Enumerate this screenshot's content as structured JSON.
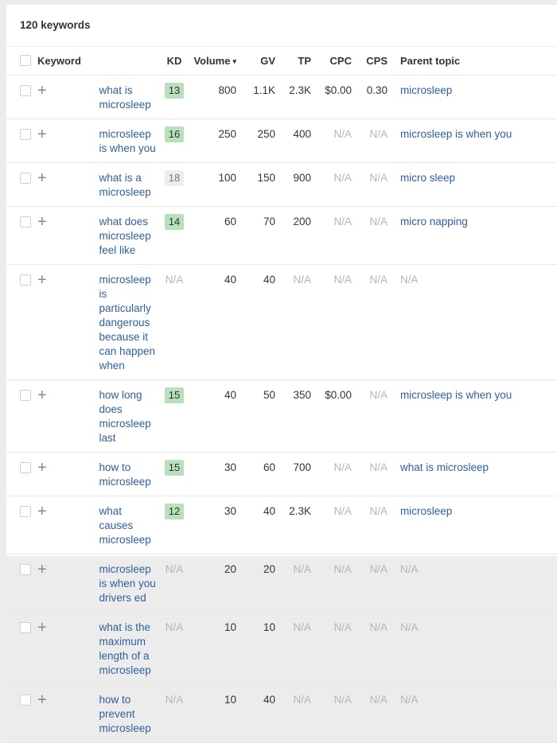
{
  "panel": {
    "title": "120 keywords"
  },
  "columns": {
    "keyword": "Keyword",
    "kd": "KD",
    "volume": "Volume",
    "volume_sort_icon": "caret-down",
    "volume_sort_glyph": "▾",
    "gv": "GV",
    "tp": "TP",
    "cpc": "CPC",
    "cps": "CPS",
    "parent_topic": "Parent topic"
  },
  "icons": {
    "add": "+"
  },
  "colors": {
    "link": "#2f5f9e",
    "kd_green": "#b7e0bb",
    "kd_gray": "#ededed",
    "na_text": "#b5b5b5"
  },
  "rows": [
    {
      "keyword": "what is microsleep",
      "kd": "13",
      "kd_style": "green",
      "volume": "800",
      "gv": "1.1K",
      "tp": "2.3K",
      "cpc": "$0.00",
      "cps": "0.30",
      "parent_topic": "microsleep"
    },
    {
      "keyword": "microsleep is when you",
      "kd": "16",
      "kd_style": "green",
      "volume": "250",
      "gv": "250",
      "tp": "400",
      "cpc": "N/A",
      "cps": "N/A",
      "parent_topic": "microsleep is when you"
    },
    {
      "keyword": "what is a microsleep",
      "kd": "18",
      "kd_style": "gray",
      "volume": "100",
      "gv": "150",
      "tp": "900",
      "cpc": "N/A",
      "cps": "N/A",
      "parent_topic": "micro sleep"
    },
    {
      "keyword": "what does microsleep feel like",
      "kd": "14",
      "kd_style": "green",
      "volume": "60",
      "gv": "70",
      "tp": "200",
      "cpc": "N/A",
      "cps": "N/A",
      "parent_topic": "micro napping"
    },
    {
      "keyword": "microsleep is particularly dangerous because it can happen when",
      "kd": "N/A",
      "kd_style": "na",
      "volume": "40",
      "gv": "40",
      "tp": "N/A",
      "cpc": "N/A",
      "cps": "N/A",
      "parent_topic": "N/A"
    },
    {
      "keyword": "how long does microsleep last",
      "kd": "15",
      "kd_style": "green",
      "volume": "40",
      "gv": "50",
      "tp": "350",
      "cpc": "$0.00",
      "cps": "N/A",
      "parent_topic": "microsleep is when you"
    },
    {
      "keyword": "how to microsleep",
      "kd": "15",
      "kd_style": "green",
      "volume": "30",
      "gv": "60",
      "tp": "700",
      "cpc": "N/A",
      "cps": "N/A",
      "parent_topic": "what is microsleep"
    },
    {
      "keyword": "what causes microsleep",
      "kd": "12",
      "kd_style": "green",
      "volume": "30",
      "gv": "40",
      "tp": "2.3K",
      "cpc": "N/A",
      "cps": "N/A",
      "parent_topic": "microsleep"
    },
    {
      "keyword": "microsleep is when you drivers ed",
      "kd": "N/A",
      "kd_style": "na",
      "volume": "20",
      "gv": "20",
      "tp": "N/A",
      "cpc": "N/A",
      "cps": "N/A",
      "parent_topic": "N/A"
    },
    {
      "keyword": "what is the maximum length of a microsleep",
      "kd": "N/A",
      "kd_style": "na",
      "volume": "10",
      "gv": "10",
      "tp": "N/A",
      "cpc": "N/A",
      "cps": "N/A",
      "parent_topic": "N/A"
    },
    {
      "keyword": "how to prevent microsleep",
      "kd": "N/A",
      "kd_style": "na",
      "volume": "10",
      "gv": "40",
      "tp": "N/A",
      "cpc": "N/A",
      "cps": "N/A",
      "parent_topic": "N/A"
    }
  ]
}
